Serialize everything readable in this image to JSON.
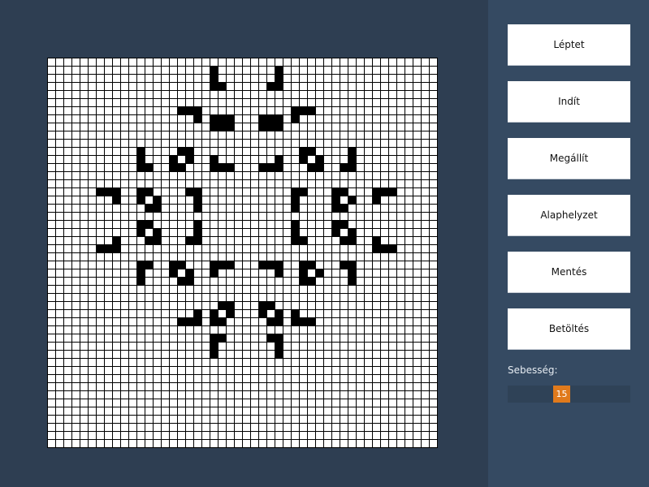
{
  "colors": {
    "background": "#2e3e52",
    "panel": "#354a62",
    "cell_alive": "#000000",
    "cell_dead": "#ffffff",
    "grid_line": "#000000",
    "slider_handle": "#e07a1c",
    "slider_track": "#2f4257"
  },
  "grid": {
    "columns": 48,
    "rows": 48,
    "alive_cells": [
      [
        20,
        1
      ],
      [
        28,
        1
      ],
      [
        20,
        2
      ],
      [
        28,
        2
      ],
      [
        20,
        3
      ],
      [
        21,
        3
      ],
      [
        27,
        3
      ],
      [
        28,
        3
      ],
      [
        16,
        6
      ],
      [
        17,
        6
      ],
      [
        18,
        6
      ],
      [
        30,
        6
      ],
      [
        31,
        6
      ],
      [
        32,
        6
      ],
      [
        18,
        7
      ],
      [
        21,
        7
      ],
      [
        22,
        7
      ],
      [
        26,
        7
      ],
      [
        27,
        7
      ],
      [
        30,
        7
      ],
      [
        20,
        7
      ],
      [
        22,
        8
      ],
      [
        26,
        8
      ],
      [
        28,
        7
      ],
      [
        20,
        8
      ],
      [
        21,
        8
      ],
      [
        27,
        8
      ],
      [
        28,
        8
      ],
      [
        11,
        11
      ],
      [
        11,
        12
      ],
      [
        11,
        13
      ],
      [
        12,
        13
      ],
      [
        16,
        11
      ],
      [
        17,
        11
      ],
      [
        15,
        12
      ],
      [
        17,
        12
      ],
      [
        15,
        13
      ],
      [
        16,
        13
      ],
      [
        20,
        13
      ],
      [
        21,
        13
      ],
      [
        22,
        13
      ],
      [
        26,
        13
      ],
      [
        27,
        13
      ],
      [
        28,
        13
      ],
      [
        20,
        12
      ],
      [
        28,
        12
      ],
      [
        31,
        11
      ],
      [
        32,
        11
      ],
      [
        31,
        12
      ],
      [
        33,
        12
      ],
      [
        32,
        13
      ],
      [
        33,
        13
      ],
      [
        37,
        11
      ],
      [
        37,
        12
      ],
      [
        36,
        13
      ],
      [
        37,
        13
      ],
      [
        6,
        16
      ],
      [
        7,
        16
      ],
      [
        8,
        16
      ],
      [
        8,
        17
      ],
      [
        11,
        16
      ],
      [
        12,
        16
      ],
      [
        11,
        17
      ],
      [
        13,
        17
      ],
      [
        12,
        18
      ],
      [
        13,
        18
      ],
      [
        17,
        16
      ],
      [
        18,
        16
      ],
      [
        18,
        17
      ],
      [
        18,
        18
      ],
      [
        30,
        16
      ],
      [
        31,
        16
      ],
      [
        30,
        17
      ],
      [
        30,
        18
      ],
      [
        35,
        16
      ],
      [
        36,
        16
      ],
      [
        35,
        17
      ],
      [
        37,
        17
      ],
      [
        35,
        18
      ],
      [
        36,
        18
      ],
      [
        40,
        16
      ],
      [
        41,
        16
      ],
      [
        42,
        16
      ],
      [
        40,
        17
      ],
      [
        6,
        23
      ],
      [
        7,
        23
      ],
      [
        8,
        23
      ],
      [
        8,
        22
      ],
      [
        11,
        20
      ],
      [
        12,
        20
      ],
      [
        11,
        21
      ],
      [
        13,
        21
      ],
      [
        12,
        22
      ],
      [
        13,
        22
      ],
      [
        18,
        20
      ],
      [
        18,
        21
      ],
      [
        18,
        22
      ],
      [
        17,
        22
      ],
      [
        30,
        20
      ],
      [
        30,
        21
      ],
      [
        30,
        22
      ],
      [
        31,
        22
      ],
      [
        35,
        20
      ],
      [
        36,
        20
      ],
      [
        35,
        21
      ],
      [
        37,
        21
      ],
      [
        36,
        22
      ],
      [
        37,
        22
      ],
      [
        40,
        22
      ],
      [
        40,
        23
      ],
      [
        41,
        23
      ],
      [
        42,
        23
      ],
      [
        11,
        25
      ],
      [
        12,
        25
      ],
      [
        11,
        26
      ],
      [
        11,
        27
      ],
      [
        15,
        25
      ],
      [
        16,
        25
      ],
      [
        15,
        26
      ],
      [
        17,
        26
      ],
      [
        16,
        27
      ],
      [
        17,
        27
      ],
      [
        20,
        25
      ],
      [
        21,
        25
      ],
      [
        22,
        25
      ],
      [
        20,
        26
      ],
      [
        26,
        25
      ],
      [
        27,
        25
      ],
      [
        28,
        25
      ],
      [
        28,
        26
      ],
      [
        31,
        25
      ],
      [
        32,
        25
      ],
      [
        31,
        26
      ],
      [
        33,
        26
      ],
      [
        31,
        27
      ],
      [
        32,
        27
      ],
      [
        36,
        25
      ],
      [
        37,
        25
      ],
      [
        37,
        26
      ],
      [
        37,
        27
      ],
      [
        16,
        32
      ],
      [
        17,
        32
      ],
      [
        18,
        32
      ],
      [
        18,
        31
      ],
      [
        21,
        30
      ],
      [
        22,
        30
      ],
      [
        20,
        31
      ],
      [
        22,
        31
      ],
      [
        20,
        32
      ],
      [
        21,
        32
      ],
      [
        26,
        30
      ],
      [
        27,
        30
      ],
      [
        26,
        31
      ],
      [
        28,
        31
      ],
      [
        27,
        32
      ],
      [
        28,
        32
      ],
      [
        30,
        31
      ],
      [
        30,
        32
      ],
      [
        31,
        32
      ],
      [
        32,
        32
      ],
      [
        20,
        34
      ],
      [
        21,
        34
      ],
      [
        20,
        35
      ],
      [
        20,
        36
      ],
      [
        27,
        34
      ],
      [
        28,
        34
      ],
      [
        28,
        35
      ],
      [
        28,
        36
      ]
    ]
  },
  "controls": {
    "step_label": "Léptet",
    "start_label": "Indít",
    "stop_label": "Megállít",
    "reset_label": "Alaphelyzet",
    "save_label": "Mentés",
    "load_label": "Betöltés"
  },
  "speed": {
    "label": "Sebesség:",
    "value": "15",
    "min": 1,
    "max": 60
  }
}
